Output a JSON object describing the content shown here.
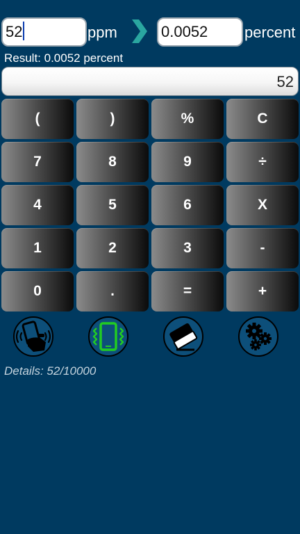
{
  "converter": {
    "from_value": "52",
    "from_unit": "ppm",
    "to_value": "0.0052",
    "to_unit": "percent",
    "arrow_icon": "chevron-right-icon"
  },
  "result": "Result: 0.0052 percent",
  "display": "52",
  "keypad": {
    "rows": [
      [
        "(",
        ")",
        "%",
        "C"
      ],
      [
        "7",
        "8",
        "9",
        "÷"
      ],
      [
        "4",
        "5",
        "6",
        "X"
      ],
      [
        "1",
        "2",
        "3",
        "-"
      ],
      [
        "0",
        ".",
        "=",
        "+"
      ]
    ]
  },
  "tools": [
    {
      "name": "shake-phone-icon",
      "color": "#000000"
    },
    {
      "name": "vibrate-phone-icon",
      "color": "#22cc22"
    },
    {
      "name": "eraser-icon",
      "color": "#000000"
    },
    {
      "name": "settings-gears-icon",
      "color": "#000000"
    }
  ],
  "details": "Details: 52/10000",
  "colors": {
    "background": "#003a60",
    "input_bg": "#ffffff",
    "arrow": "#2aa6a0",
    "vibrate_active": "#22cc22",
    "details_text": "#c5d4de"
  }
}
